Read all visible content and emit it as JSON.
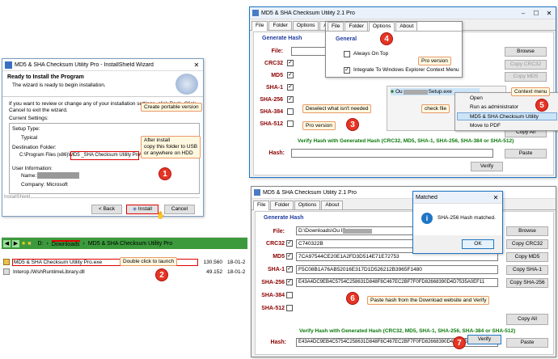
{
  "installer": {
    "title": "MD5 & SHA Checksum Utility Pro - InstallShield Wizard",
    "heading": "Ready to Install the Program",
    "subheading": "The wizard is ready to begin installation.",
    "intro": "If you want to review or change any of your installation settings, click Back. Click Cancel to exit the wizard.",
    "current_settings": "Current Settings:",
    "setup_type_label": "Setup Type:",
    "setup_type_value": "Typical",
    "dest_label": "Destination Folder:",
    "dest_value": "C:\\Program Files (x86)\\MD5 _SHA Checksum Utility Pro\\",
    "user_label": "User Information:",
    "name_label": "Name:",
    "company_label": "Company: Microsoft",
    "footer": "InstallShield",
    "back": "< Back",
    "install": "Install",
    "cancel": "Cancel"
  },
  "callouts": {
    "portable": "Create portable version",
    "after_install": "After install\ncopy this folder to USB\nor anywhere on HDD",
    "double_click": "Double click to launch",
    "pro_version_top": "Pro version",
    "deselect": "Deselect what isn't needed",
    "pro_version": "Pro version",
    "check_file": "check file",
    "context_menu": "Context menu",
    "paste_hash": "Paste hash from the Download website and Verify"
  },
  "badges": [
    "1",
    "2",
    "3",
    "4",
    "5",
    "6",
    "7"
  ],
  "explorer": {
    "path_drive": "D:",
    "path_folder": "Downloads",
    "path_sub": "MD5 & SHA Checksum Utility Pro",
    "files": [
      {
        "name": "MD5 & SHA Checksum Utility Pro.exe",
        "size": "130.560",
        "date": "18-01-2"
      },
      {
        "name": "Interop.IWshRuntimeLibrary.dll",
        "size": "49.152",
        "date": "18-01-2"
      }
    ]
  },
  "util_top": {
    "title": "MD5 & SHA Checksum Utility 2.1 Pro",
    "tabs": [
      "File",
      "Folder",
      "Options",
      "About"
    ],
    "generate": "Generate Hash",
    "file_label": "File:",
    "labels": [
      "CRC32",
      "MD5",
      "SHA-1",
      "SHA-256",
      "SHA-384",
      "SHA-512"
    ],
    "browse": "Browse",
    "copy_buttons": [
      "Copy CRC32",
      "Copy MD5"
    ],
    "copy_all": "Copy All",
    "verify_section": "Verify Hash with Generated Hash (CRC32, MD5, SHA-1, SHA-256, SHA-384 or SHA-512)",
    "hash_label": "Hash:",
    "paste": "Paste",
    "verify": "Verify"
  },
  "options_panel": {
    "tabs": [
      "File",
      "Folder",
      "Options",
      "About"
    ],
    "general": "General",
    "always_on_top": "Always On Top",
    "integrate": "Integrate To Windows Explorer Context Menu"
  },
  "context": {
    "file_name": "Ou",
    "file_suffix": "Setup.exe",
    "items": [
      "Open",
      "Run as administrator",
      "MD5 & SHA Checksum Utility",
      "Move to PDF"
    ]
  },
  "util_bottom": {
    "title": "MD5 & SHA Checksum Utility 2.1 Pro",
    "tabs": [
      "File",
      "Folder",
      "Options",
      "About"
    ],
    "generate": "Generate Hash",
    "file_label": "File:",
    "file_value": "D:\\Downloads\\Ou                    lSetup.exe",
    "rows": [
      {
        "label": "CRC32",
        "value": "C740322B",
        "copy": "Copy CRC32",
        "checked": true
      },
      {
        "label": "MD5",
        "value": "7CA97544CE20E1A2FD3D514E71E72753",
        "copy": "Copy MD5",
        "checked": true
      },
      {
        "label": "SHA-1",
        "value": "F5C08B1A76AB52016E317D1D526212B3965F1480",
        "copy": "Copy SHA-1",
        "checked": true
      },
      {
        "label": "SHA-256",
        "value": "E43A4DC9EB4C5754C258631D848F8C467EC2BF7F0FD82668390D4D7535A0EF11",
        "copy": "Copy SHA-256",
        "checked": true
      },
      {
        "label": "SHA-384",
        "value": "",
        "copy": "",
        "checked": false
      },
      {
        "label": "SHA-512",
        "value": "",
        "copy": "",
        "checked": false
      }
    ],
    "browse": "Browse",
    "copy_all": "Copy All",
    "verify_section": "Verify Hash with Generated Hash (CRC32, MD5, SHA-1, SHA-256, SHA-384 or SHA-512)",
    "hash_label": "Hash:",
    "hash_value": "E43A4DC9EB4C5754C258631D848F8C467EC2BF7F0FD82668390D4D7535A0EF11",
    "paste": "Paste",
    "verify": "Verify"
  },
  "dialog": {
    "title": "Matched",
    "message": "SHA-256 Hash matched.",
    "ok": "OK"
  }
}
